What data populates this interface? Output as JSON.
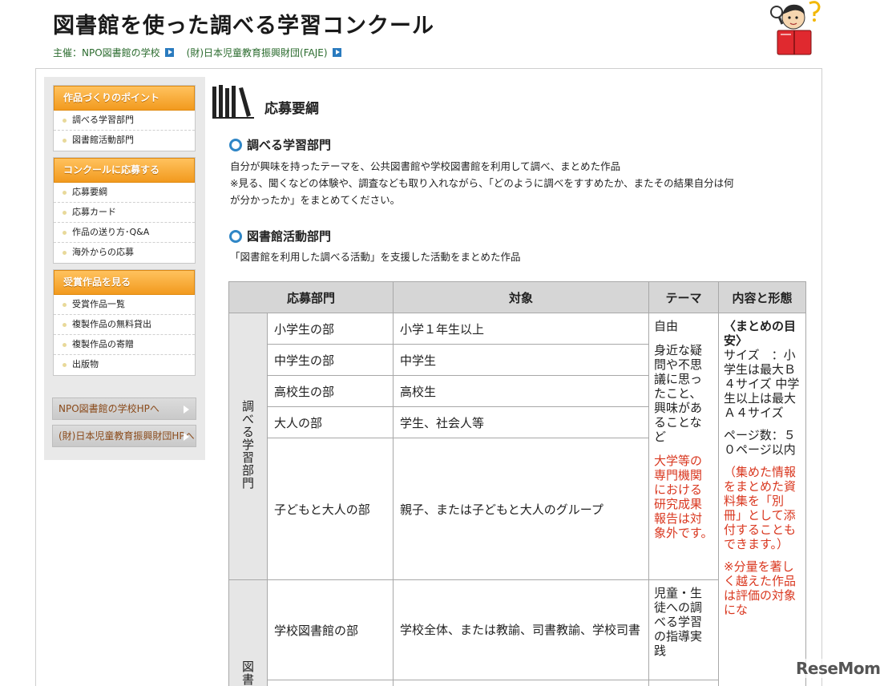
{
  "header": {
    "title": "図書館を使った調べる学習コンクール",
    "organizers_label": "主催：NPO図書館の学校",
    "organizer_2": "(財)日本児童教育振興財団(FAJE)"
  },
  "sidebar": {
    "sections": [
      {
        "heading": "作品づくりのポイント",
        "items": [
          "調べる学習部門",
          "図書館活動部門"
        ]
      },
      {
        "heading": "コンクールに応募する",
        "items": [
          "応募要綱",
          "応募カード",
          "作品の送り方･Q&A",
          "海外からの応募"
        ]
      },
      {
        "heading": "受賞作品を見る",
        "items": [
          "受賞作品一覧",
          "複製作品の無料貸出",
          "複製作品の寄贈",
          "出版物"
        ]
      }
    ],
    "links": [
      "NPO図書館の学校HPへ",
      "(財)日本児童教育振興財団HPへ"
    ]
  },
  "main": {
    "section_title": "応募要綱",
    "dept1": {
      "title": "調べる学習部門",
      "desc1": "自分が興味を持ったテーマを、公共図書館や学校図書館を利用して調べ、まとめた作品",
      "desc2a": "※見る、聞くなどの体験や、調査なども取り入れながら、「どのように調べをすすめたか、またその結果自分は何",
      "desc2b": "が分かったか」をまとめてください。"
    },
    "dept2": {
      "title": "図書館活動部門",
      "desc": "「図書館を利用した調べる活動」を支援した活動をまとめた作品"
    }
  },
  "table": {
    "headers": [
      "応募部門",
      "対象",
      "テーマ",
      "内容と形態"
    ],
    "group1": "調べる学習部門",
    "group2": "図書",
    "rows": [
      {
        "division": "小学生の部",
        "target": "小学１年生以上"
      },
      {
        "division": "中学生の部",
        "target": "中学生"
      },
      {
        "division": "高校生の部",
        "target": "高校生"
      },
      {
        "division": "大人の部",
        "target": "学生、社会人等"
      },
      {
        "division": "子どもと大人の部",
        "target": "親子、または子どもと大人のグループ"
      },
      {
        "division": "学校図書館の部",
        "target": "学校全体、または教諭、司書教諭、学校司書"
      }
    ],
    "theme1": "自由",
    "theme2": "身近な疑問や不思議に思ったこと、興味があることなど",
    "theme_note": "大学等の専門機関における研究成果報告は対象外です。",
    "theme3": "児童・生徒への調べる学習の指導実践",
    "format_title": "〈まとめの目安〉",
    "format_size": "サイズ　：小学生は最大Ｂ４サイズ 中学生以上は最大Ａ４サイズ",
    "format_pages": "ページ数：５０ページ以内",
    "format_note1": "（集めた情報をまとめた資料集を「別冊」として添付することもできます。）",
    "format_note2": "※分量を著しく越えた作品は評価の対象にな"
  },
  "watermark": "ReseMom",
  "colors": {
    "accent_orange": "#f29a1e",
    "ring_blue": "#2f86c6",
    "note_red": "#d9371f",
    "organizer_green": "#2b6b2e"
  }
}
